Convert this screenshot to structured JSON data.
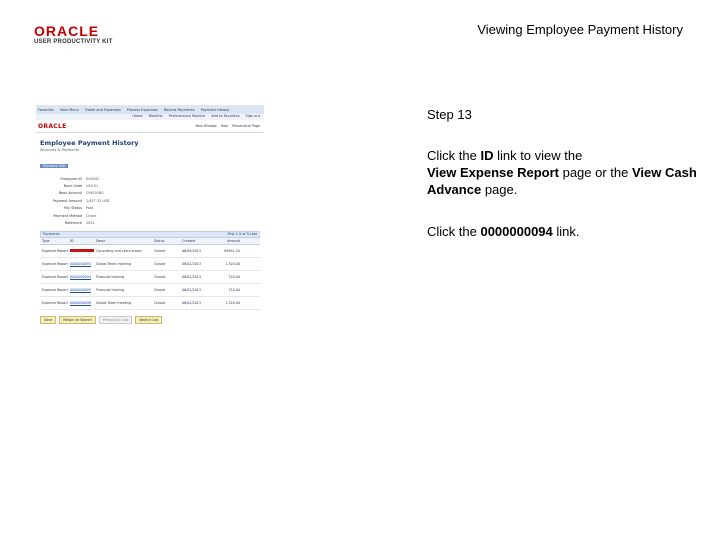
{
  "brand": {
    "logo_word": "ORACLE",
    "logo_sub": "USER PRODUCTIVITY KIT"
  },
  "slide": {
    "title": "Viewing Employee Payment History"
  },
  "instructions": {
    "step": "Step 13",
    "p1_a": "Click the ",
    "p1_id": "ID",
    "p1_b": " link to view the",
    "p1_page1": "View Expense Report",
    "p1_c": " page or the ",
    "p1_page2": "View Cash Advance",
    "p1_d": " page.",
    "p2_a": "Click the ",
    "p2_link": "0000000094",
    "p2_b": " link."
  },
  "screenshot": {
    "topnav": [
      "Favorites",
      "Main Menu",
      "Travel and Expenses",
      "Process Expenses",
      "Review Payments",
      "Payment History"
    ],
    "navlinks": [
      "Home",
      "Worklist",
      "Performance Monitor",
      "Add to Favorites",
      "Sign out"
    ],
    "logo": "ORACLE",
    "pagelinks": [
      "New Window",
      "Help",
      "Personalize Page"
    ],
    "page_title": "Employee Payment History",
    "page_sub": "Accounts & Payments",
    "tab": "Payment Info",
    "fields": [
      {
        "label": "Employee ID",
        "value": "KU0042"
      },
      {
        "label": "Bank Code",
        "value": "US0 01"
      },
      {
        "label": "Bank Account",
        "value": "CHECKING"
      },
      {
        "label": "Payment Amount",
        "value": "1,657.32 USD"
      },
      {
        "label": "Pay Status",
        "value": "Paid"
      },
      {
        "label": "Payment Method",
        "value": "Check"
      },
      {
        "label": "Reference",
        "value": "2051"
      }
    ],
    "grid_title": "Payments",
    "grid_nav": "First 1-5 of 5 Last",
    "columns": [
      "Type",
      "ID",
      "Descr",
      "Status",
      "Created",
      "Amount"
    ],
    "rows": [
      {
        "type": "Expense Report",
        "id": "",
        "descr": "Consulting and client travel",
        "status": "Closed",
        "date": "06/09/2013",
        "amount": "69951.20"
      },
      {
        "type": "Expense Report",
        "id": "0000000093",
        "descr": "Global Team meeting",
        "status": "Closed",
        "date": "06/02/2013",
        "amount": "1,520.00"
      },
      {
        "type": "Expense Report",
        "id": "0000000094",
        "descr": "Financial training",
        "status": "Closed",
        "date": "06/02/2013",
        "amount": "720.00"
      },
      {
        "type": "Expense Report",
        "id": "0000000095",
        "descr": "Financial training",
        "status": "Closed",
        "date": "06/02/2013",
        "amount": "720.00"
      },
      {
        "type": "Expense Report",
        "id": "0000000096",
        "descr": "Global Team meeting",
        "status": "Closed",
        "date": "06/02/2013",
        "amount": "1,520.00"
      }
    ],
    "buttons": [
      "Save",
      "Return to Search",
      "Previous in List",
      "Next in List"
    ]
  },
  "colors": {
    "brand_red": "#c00000",
    "link_blue": "#1f4fb0",
    "highlight": "#cc1111"
  }
}
